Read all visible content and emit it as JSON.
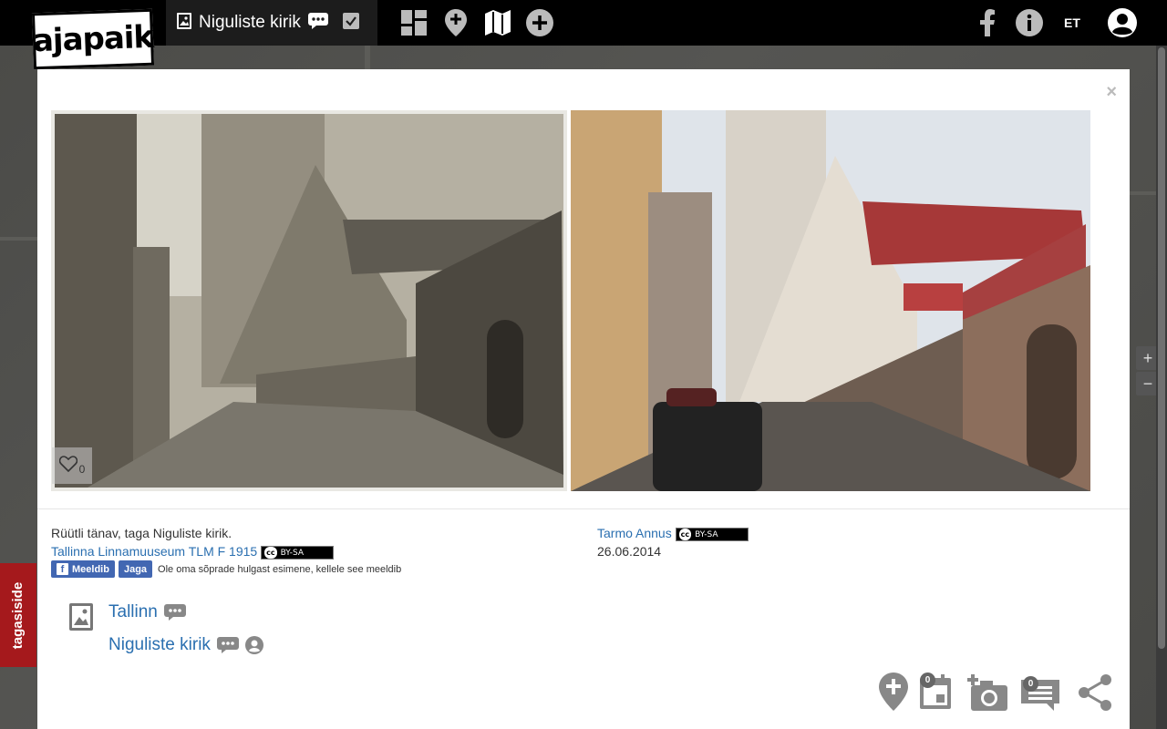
{
  "app": {
    "logo_text": "ajapaik"
  },
  "nav": {
    "title": "Niguliste kirik",
    "icons": [
      "photo-icon",
      "comment-icon",
      "check-icon",
      "grid-icon",
      "location-pin-icon",
      "map-icon",
      "add-icon"
    ],
    "right": {
      "facebook_icon": "facebook-icon",
      "info_icon": "info-icon",
      "language": "ET",
      "account_icon": "account-icon"
    }
  },
  "modal": {
    "close_label": "×",
    "old_photo": {
      "like_count": "0"
    },
    "description": "Rüütli tänav, taga Niguliste kirik.",
    "source_link": "Tallinna Linnamuuseum TLM F 1915",
    "license_label": "BY-SA",
    "license_cc": "cc",
    "facebook": {
      "like_label": "Meeldib",
      "share_label": "Jaga",
      "like_text": "Ole oma sõprade hulgast esimene, kellele see meeldib"
    },
    "rephoto": {
      "author": "Tarmo Annus",
      "license_label": "BY-SA",
      "license_cc": "cc",
      "date": "26.06.2014"
    },
    "albums": [
      {
        "label": "Tallinn"
      },
      {
        "label": "Niguliste kirik"
      }
    ],
    "actions": {
      "dating_count": "0",
      "comment_count": "0"
    }
  },
  "feedback_label": "tagasiside",
  "colors": {
    "link": "#2a6fb0",
    "topbar": "#000000",
    "feedback": "#a5191c",
    "facebook": "#4267b2"
  }
}
